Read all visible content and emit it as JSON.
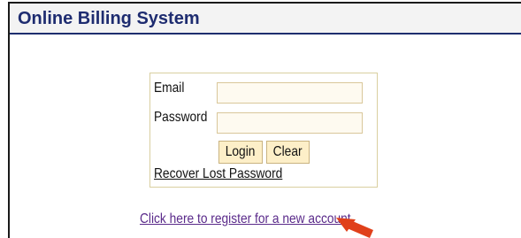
{
  "header": {
    "title": "Online Billing System",
    "accent_color": "#1e2c70"
  },
  "login_form": {
    "email_label": "Email",
    "email_value": "",
    "password_label": "Password",
    "password_value": "",
    "login_button_label": "Login",
    "clear_button_label": "Clear",
    "recover_link_text": "Recover Lost Password"
  },
  "register": {
    "link_text": "Click here to register for a new account",
    "link_color": "#5a2a8a"
  },
  "annotation": {
    "arrow_icon": "red-arrow-icon",
    "arrow_color": "#e0401a"
  }
}
